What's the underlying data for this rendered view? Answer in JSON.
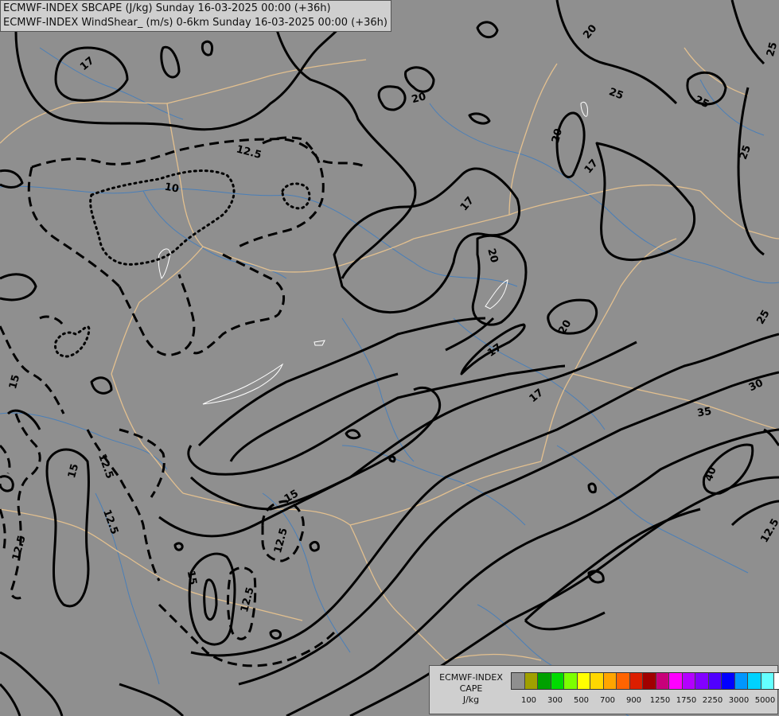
{
  "header": {
    "line1": "ECMWF-INDEX SBCAPE (J/kg) Sunday 16-03-2025 00:00 (+36h)",
    "line2": "ECMWF-INDEX WindShear_ (m/s) 0-6km Sunday 16-03-2025 00:00 (+36h)"
  },
  "legend": {
    "title_line1": "ECMWF-INDEX",
    "title_line2": "CAPE",
    "title_line3": "J/kg",
    "colors": [
      "#8f8f8f",
      "#a0a000",
      "#00a000",
      "#00dc00",
      "#7cff00",
      "#ffff00",
      "#ffd700",
      "#ffa500",
      "#ff6400",
      "#dc1e00",
      "#a00000",
      "#c8007a",
      "#ff00ff",
      "#b400ff",
      "#8200ff",
      "#5000ff",
      "#0000ff",
      "#0096ff",
      "#00d2ff",
      "#64ffff",
      "#ffffff"
    ],
    "ticks": [
      "100",
      "300",
      "500",
      "700",
      "900",
      "1250",
      "1750",
      "2250",
      "3000",
      "5000"
    ]
  },
  "map": {
    "contour_labels": [
      {
        "text": "17"
      },
      {
        "text": "20"
      },
      {
        "text": "20"
      },
      {
        "text": "25"
      },
      {
        "text": "25"
      },
      {
        "text": "25"
      },
      {
        "text": "12.5"
      },
      {
        "text": "10"
      },
      {
        "text": "17"
      },
      {
        "text": "20"
      },
      {
        "text": "20"
      },
      {
        "text": "17"
      },
      {
        "text": "20"
      },
      {
        "text": "17"
      },
      {
        "text": "25"
      },
      {
        "text": "17"
      },
      {
        "text": "30"
      },
      {
        "text": "35"
      },
      {
        "text": "40"
      },
      {
        "text": "25"
      },
      {
        "text": "15"
      },
      {
        "text": "15"
      },
      {
        "text": "12.5"
      },
      {
        "text": "15"
      },
      {
        "text": "12.5"
      },
      {
        "text": "12.5"
      },
      {
        "text": "12.5"
      },
      {
        "text": "12.5"
      },
      {
        "text": "15"
      },
      {
        "text": "12.5"
      }
    ]
  }
}
